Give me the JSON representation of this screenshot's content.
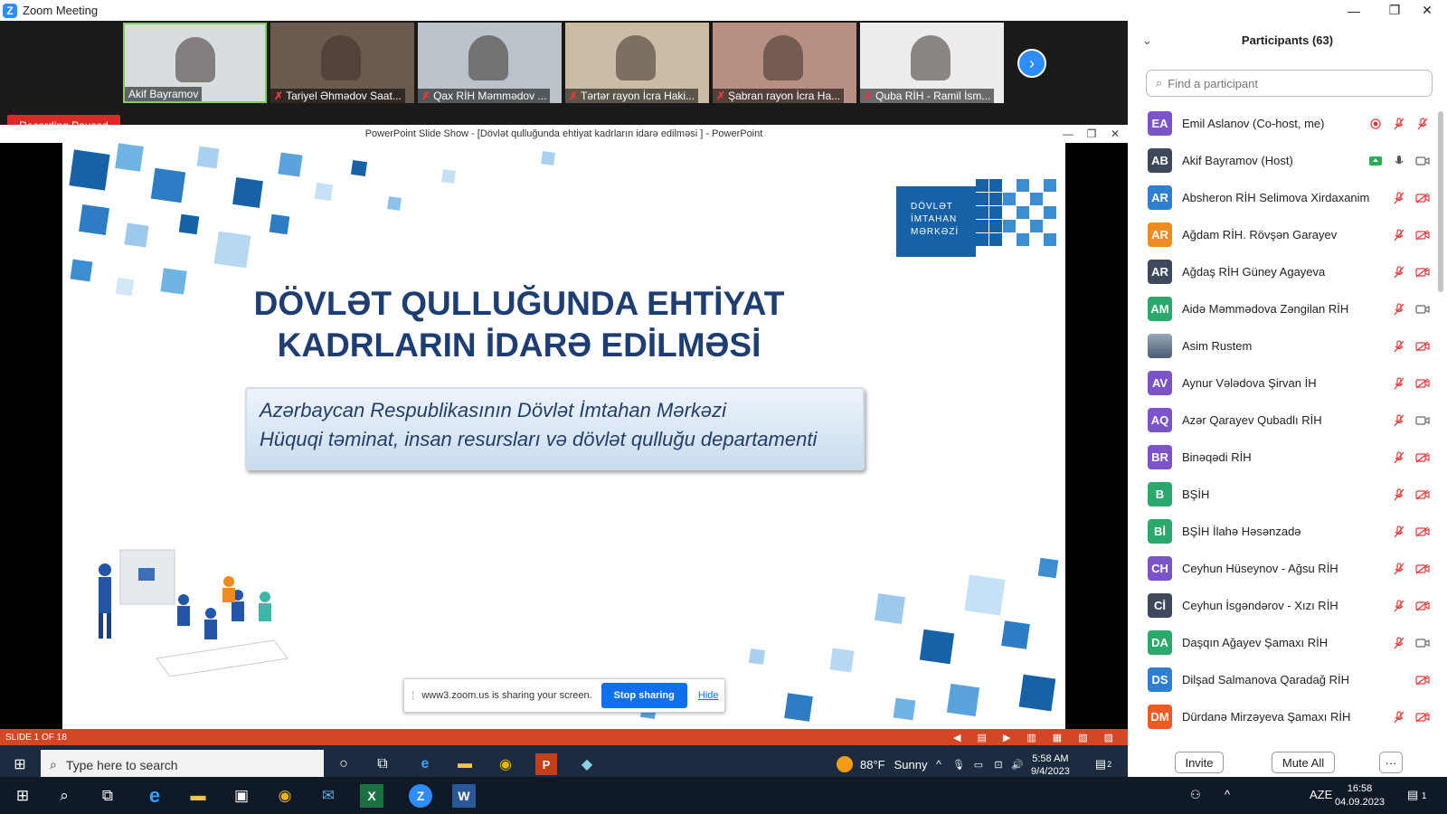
{
  "window": {
    "title": "Zoom Meeting",
    "logo_letter": "Z",
    "minimize": "—",
    "maximize": "❐",
    "close": "✕"
  },
  "thumbnails": [
    {
      "name": "Akif Bayramov",
      "muted": false,
      "bg": "#d8dde0"
    },
    {
      "name": "Tariyel Əhmədov Saat...",
      "muted": true,
      "bg": "#6b5a4e"
    },
    {
      "name": "Qax RİH Məmmədov ...",
      "muted": true,
      "bg": "#b9c3c9"
    },
    {
      "name": "Tərtər rayon İcra Haki...",
      "muted": true,
      "bg": "#cbbca5"
    },
    {
      "name": "Şabran rayon İcra Ha...",
      "muted": true,
      "bg": "#b88f83"
    },
    {
      "name": "Quba RİH - Ramil İsm...",
      "muted": true,
      "bg": "#ececec"
    }
  ],
  "mute_symbol": "✗",
  "next_arrow": "›",
  "recording_label": "Recording Paused",
  "ppt": {
    "window_title": "PowerPoint Slide Show - [Dövlət qulluğunda ehtiyat kadrların idarə edilməsi ] - PowerPoint",
    "ctrl_min": "—",
    "ctrl_max": "❐",
    "ctrl_close": "✕",
    "title_line1": "DÖVLƏT QULLUĞUNDA EHTİYAT",
    "title_line2": "KADRLARIN İDARƏ EDİLMƏSİ",
    "subtitle_line1": "Azərbaycan Respublikasının Dövlət İmtahan Mərkəzi",
    "subtitle_line2": "Hüquqi təminat, insan resursları və dövlət qulluğu departamenti",
    "logo_line1": "DÖVLƏT",
    "logo_line2": "İMTAHAN",
    "logo_line3": "MƏRKƏZİ",
    "slide_counter": "SLIDE 1 OF 18",
    "status_icons": [
      "◀",
      "▤",
      "▶",
      "▥",
      "▦",
      "▧",
      "▨"
    ]
  },
  "share_bar": {
    "grip": "⁞",
    "message": "www3.zoom.us is sharing your screen.",
    "stop_label": "Stop sharing",
    "hide_label": "Hide"
  },
  "inner_taskbar": {
    "search_placeholder": "Type here to search",
    "weather_temp": "88°F",
    "weather_desc": "Sunny",
    "time": "5:58 AM",
    "date": "9/4/2023",
    "notif_count": "2",
    "icons": {
      "start": "⊞",
      "search": "⌕",
      "cortana": "○",
      "taskview": "⧉",
      "edge": "e",
      "explorer": "▬",
      "chrome": "◉",
      "powerpoint": "P",
      "app": "◆",
      "tray_up": "^",
      "mic": "🎙",
      "battery": "▭",
      "network": "⊡",
      "volume": "🔊",
      "notif": "▤"
    }
  },
  "participants": {
    "title": "Participants (63)",
    "collapse": "⌄",
    "search_placeholder": "Find a participant",
    "search_icon": "⌕",
    "items": [
      {
        "initials": "EA",
        "name": "Emil Aslanov (Co-host, me)",
        "color": "#7b54c9",
        "mic": "muted",
        "video": "rec"
      },
      {
        "initials": "AB",
        "name": "Akif Bayramov (Host)",
        "color": "#3e4a5b",
        "mic": "on",
        "video": "on",
        "share": true
      },
      {
        "initials": "AR",
        "name": "Absheron RİH Selimova Xirdaxanim",
        "color": "#2f7fd0",
        "mic": "muted",
        "video": "off"
      },
      {
        "initials": "AR",
        "name": "Ağdam RİH. Rövşən Garayev",
        "color": "#f08c1f",
        "mic": "muted",
        "video": "off"
      },
      {
        "initials": "AR",
        "name": "Ağdaş RİH Güney Agayeva",
        "color": "#3e4a5b",
        "mic": "muted",
        "video": "off"
      },
      {
        "initials": "AM",
        "name": "Aidə Məmmədova Zəngilan RİH",
        "color": "#29a96b",
        "mic": "muted",
        "video": "on"
      },
      {
        "initials": "",
        "name": "Asim Rustem",
        "color": "#5a6f86",
        "mic": "muted",
        "video": "off",
        "photo": true
      },
      {
        "initials": "AV",
        "name": "Aynur Vələdova Şirvan İH",
        "color": "#7b54c9",
        "mic": "muted",
        "video": "off"
      },
      {
        "initials": "AQ",
        "name": "Azər Qarayev  Qubadlı RİH",
        "color": "#7b54c9",
        "mic": "muted",
        "video": "on"
      },
      {
        "initials": "BR",
        "name": "Binəqədi RİH",
        "color": "#7b54c9",
        "mic": "muted",
        "video": "off"
      },
      {
        "initials": "B",
        "name": "BŞİH",
        "color": "#29a96b",
        "mic": "muted",
        "video": "off"
      },
      {
        "initials": "Bİ",
        "name": "BŞİH İlahə Həsənzadə",
        "color": "#29a96b",
        "mic": "muted",
        "video": "off"
      },
      {
        "initials": "CH",
        "name": "Ceyhun Hüseynov - Ağsu RİH",
        "color": "#7b54c9",
        "mic": "muted",
        "video": "off"
      },
      {
        "initials": "Cİ",
        "name": "Ceyhun İsgəndərov - Xızı RİH",
        "color": "#3e4a5b",
        "mic": "muted",
        "video": "off"
      },
      {
        "initials": "DA",
        "name": "Daşqın Ağayev Şamaxı RİH",
        "color": "#29a96b",
        "mic": "muted",
        "video": "on"
      },
      {
        "initials": "DS",
        "name": "Dilşad Salmanova Qaradağ RİH",
        "color": "#2f7fd0",
        "mic": "none",
        "video": "off"
      },
      {
        "initials": "DM",
        "name": "Dürdanə Mirzəyeva Şamaxı RİH",
        "color": "#f05a1f",
        "mic": "muted",
        "video": "off"
      }
    ],
    "invite_label": "Invite",
    "mute_all_label": "Mute All",
    "more_label": "···"
  },
  "outer_taskbar": {
    "icons": {
      "start": "⊞",
      "search": "⌕",
      "taskview": "⧉",
      "edge": "e",
      "explorer": "▬",
      "store": "▣",
      "chrome": "◉",
      "mail": "✉",
      "excel": "X",
      "zoom": "Z",
      "word": "W"
    },
    "tray_people": "⚇",
    "tray_up": "^",
    "tray_lang": "AZE",
    "time": "16:58",
    "date": "04.09.2023",
    "notif_count": "1"
  },
  "colors": {
    "zoom_blue": "#2D8CFF",
    "ppt_orange": "#d24726",
    "rec_red": "#e02828",
    "mute_red": "#e23b3b"
  }
}
